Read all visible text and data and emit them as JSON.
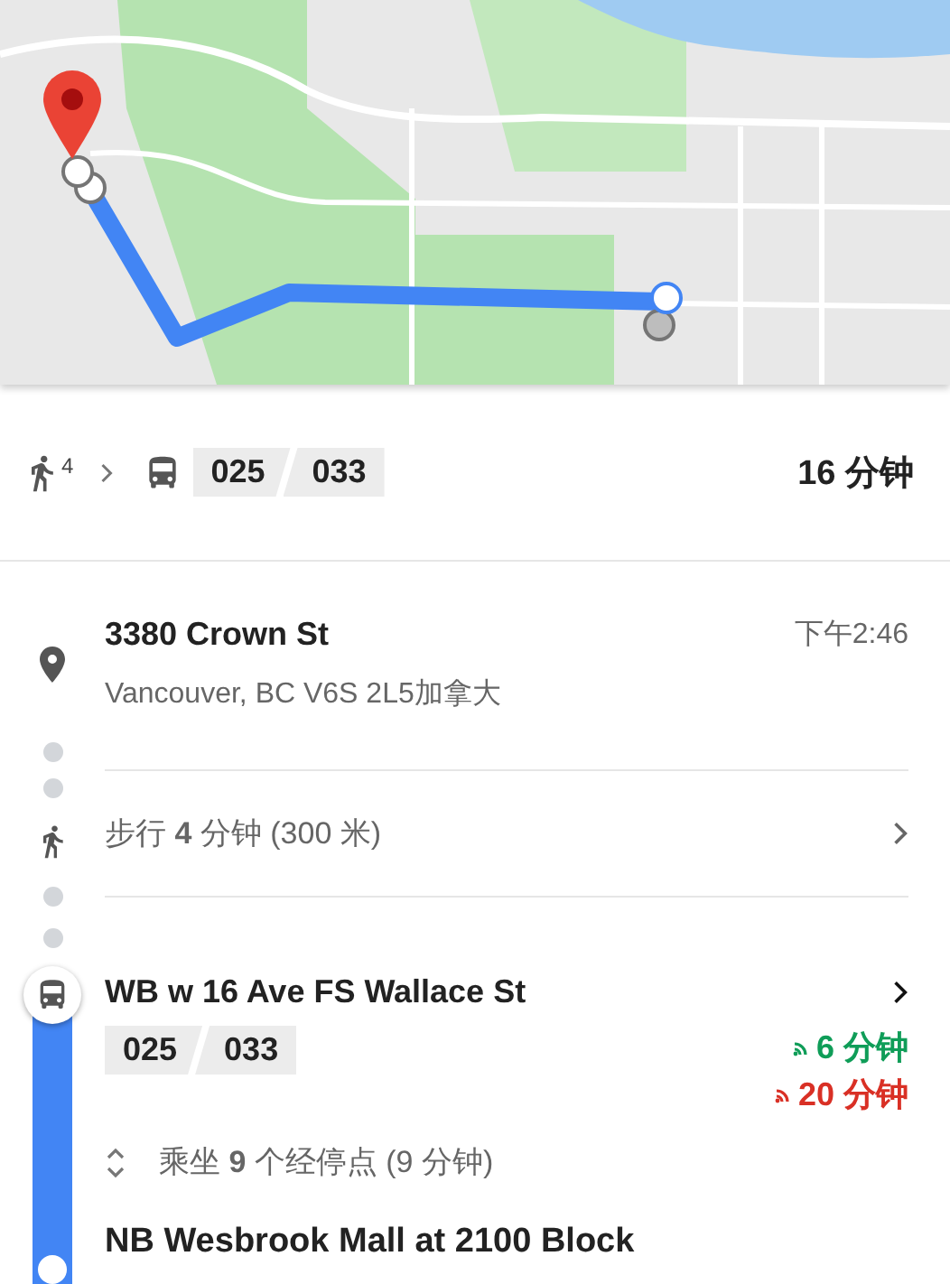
{
  "summary": {
    "walk_minutes": "4",
    "routes": [
      "025",
      "033"
    ],
    "duration": "16 分钟"
  },
  "steps": [
    {
      "kind": "place",
      "name": "3380 Crown St",
      "time": "下午2:46",
      "address": "Vancouver, BC V6S 2L5加拿大"
    },
    {
      "kind": "walk",
      "text": "步行 **4** 分钟 (300 米)"
    },
    {
      "kind": "transit",
      "stop": "WB w 16 Ave FS Wallace St",
      "routes": [
        "025",
        "033"
      ],
      "departures": [
        {
          "time": "6 分钟",
          "color": "#0f9d58"
        },
        {
          "time": "20 分钟",
          "color": "#d93025"
        }
      ],
      "ride": "乘坐 **9** 个经停点 (9 分钟)",
      "end_stop": "NB Wesbrook Mall at 2100 Block"
    }
  ]
}
